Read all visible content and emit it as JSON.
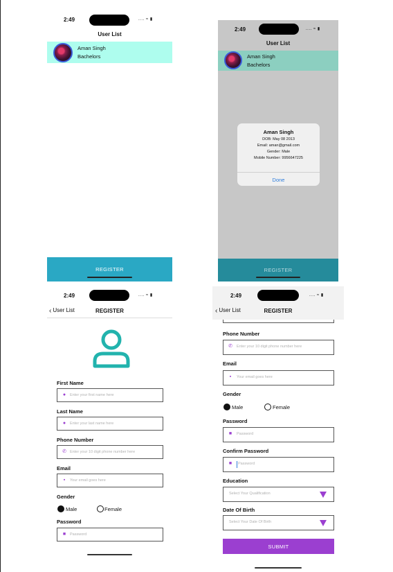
{
  "status": {
    "time": "2:49",
    "signal": "....",
    "wifi": "wifi-icon",
    "battery": "battery-icon"
  },
  "user_list": {
    "title": "User List",
    "users": [
      {
        "name": "Aman Singh",
        "education": "Bachelors"
      }
    ],
    "register_label": "REGISTER",
    "colors": {
      "row": "#aefdee",
      "footer": "#2aa8c4"
    }
  },
  "alert": {
    "title": "Aman Singh",
    "dob": "DOB: May 08 2013",
    "email": "Email: aman@gmail.com",
    "gender": "Gender: Male",
    "mobile": "Mobile Number: 9956647225",
    "done_label": "Done"
  },
  "register": {
    "back_label": "User List",
    "title": "REGISTER",
    "fields": {
      "first_name": {
        "label": "First Name",
        "placeholder": "Enter your first name here"
      },
      "last_name": {
        "label": "Last Name",
        "placeholder": "Enter your last name here"
      },
      "phone": {
        "label": "Phone Number",
        "placeholder": "Enter your 10 digit phone number here"
      },
      "email": {
        "label": "Email",
        "placeholder": "Your email goes here"
      },
      "password": {
        "label": "Password",
        "placeholder": "Password"
      },
      "confirm_password": {
        "label": "Confirm Password",
        "placeholder": "Password"
      },
      "education": {
        "label": "Education",
        "placeholder": "Select Your Qualification"
      },
      "dob": {
        "label": "Date Of Birth",
        "placeholder": "Select Your Date Of Birth"
      }
    },
    "gender": {
      "label": "Gender",
      "options": [
        "Male",
        "Female"
      ],
      "selected": "Male"
    },
    "submit_label": "SUBMIT",
    "colors": {
      "accent": "#9b3fd0",
      "avatar": "#22b3ad"
    }
  }
}
